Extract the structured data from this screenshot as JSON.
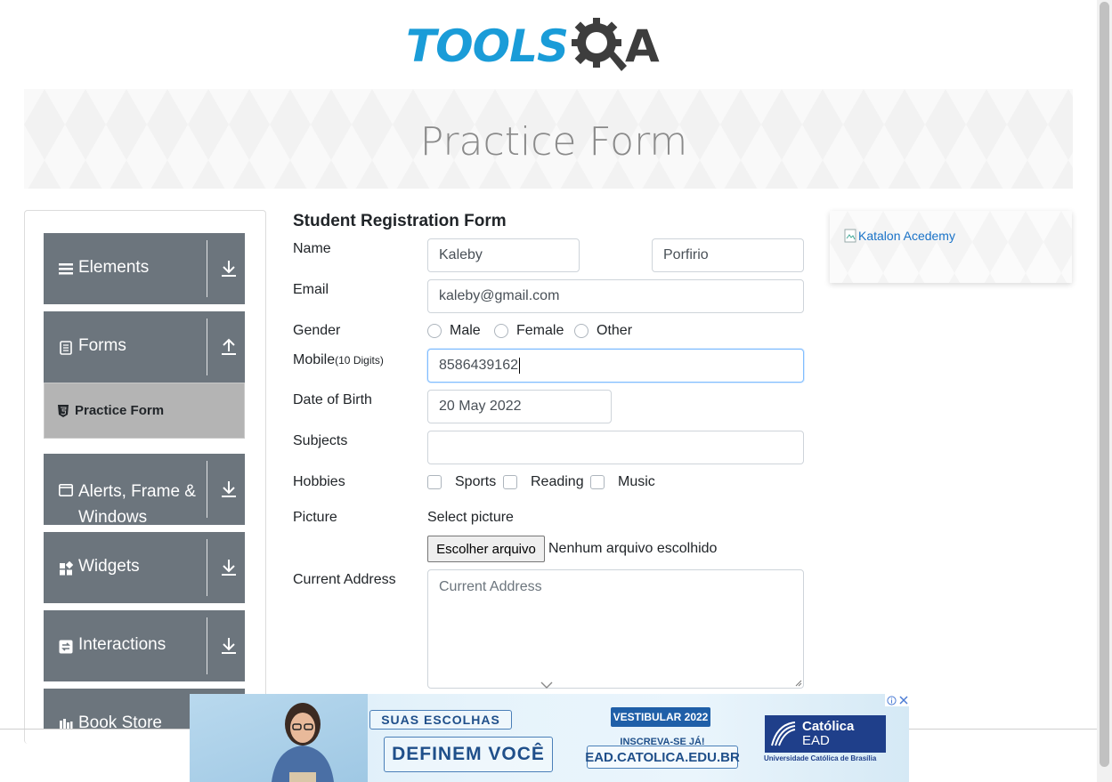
{
  "header": {
    "logo_text_left": "TOOLS",
    "logo_text_right": "A"
  },
  "banner": {
    "title": "Practice Form"
  },
  "sidebar": {
    "groups": [
      {
        "label": "Elements",
        "icon": "menu-icon",
        "arrow": "download-arrow-icon"
      },
      {
        "label": "Forms",
        "icon": "document-icon",
        "arrow": "upload-arrow-icon"
      },
      {
        "label": "Alerts, Frame &",
        "label2": "Windows",
        "icon": "window-icon",
        "arrow": "download-arrow-icon"
      },
      {
        "label": "Widgets",
        "icon": "widgets-icon",
        "arrow": "download-arrow-icon"
      },
      {
        "label": "Interactions",
        "icon": "interactions-icon",
        "arrow": "download-arrow-icon"
      },
      {
        "label": "Book Store",
        "icon": "bookstore-icon",
        "arrow": "download-arrow-icon"
      }
    ],
    "active_item": {
      "label": "Practice Form",
      "icon": "html5-icon"
    }
  },
  "form": {
    "title": "Student Registration Form",
    "name_label": "Name",
    "first_name": "Kaleby",
    "last_name": "Porfirio",
    "email_label": "Email",
    "email": "kaleby@gmail.com",
    "gender_label": "Gender",
    "genders": [
      "Male",
      "Female",
      "Other"
    ],
    "mobile_label": "Mobile",
    "mobile_hint": "(10 Digits)",
    "mobile": "8586439162",
    "dob_label": "Date of Birth",
    "dob": "20 May 2022",
    "subjects_label": "Subjects",
    "subjects": "",
    "hobbies_label": "Hobbies",
    "hobbies": [
      "Sports",
      "Reading",
      "Music"
    ],
    "picture_label": "Picture",
    "picture_prompt": "Select picture",
    "file_button": "Escolher arquivo",
    "file_status": "Nenhum arquivo escolhido",
    "address_label": "Current Address",
    "address_placeholder": "Current Address"
  },
  "ad_right": {
    "alt_text": "Katalon Acedemy"
  },
  "ad_bottom": {
    "slogan1": "SUAS ESCOLHAS",
    "slogan2": "DEFINEM VOCÊ",
    "vestibular": "VESTIBULAR 2022",
    "inscreva": "INSCREVA-SE JÁ!",
    "url": "EAD.CATOLICA.EDU.BR",
    "brand_line1": "Católica",
    "brand_line2": "EAD",
    "brand_sub": "Universidade Católica de Brasília"
  },
  "colors": {
    "sidebar_group": "#6c757d",
    "active_item": "#b4b4b4",
    "logo_blue": "#1a9cd8",
    "logo_dark": "#3d3d3d",
    "focus_border": "#80bdff"
  }
}
